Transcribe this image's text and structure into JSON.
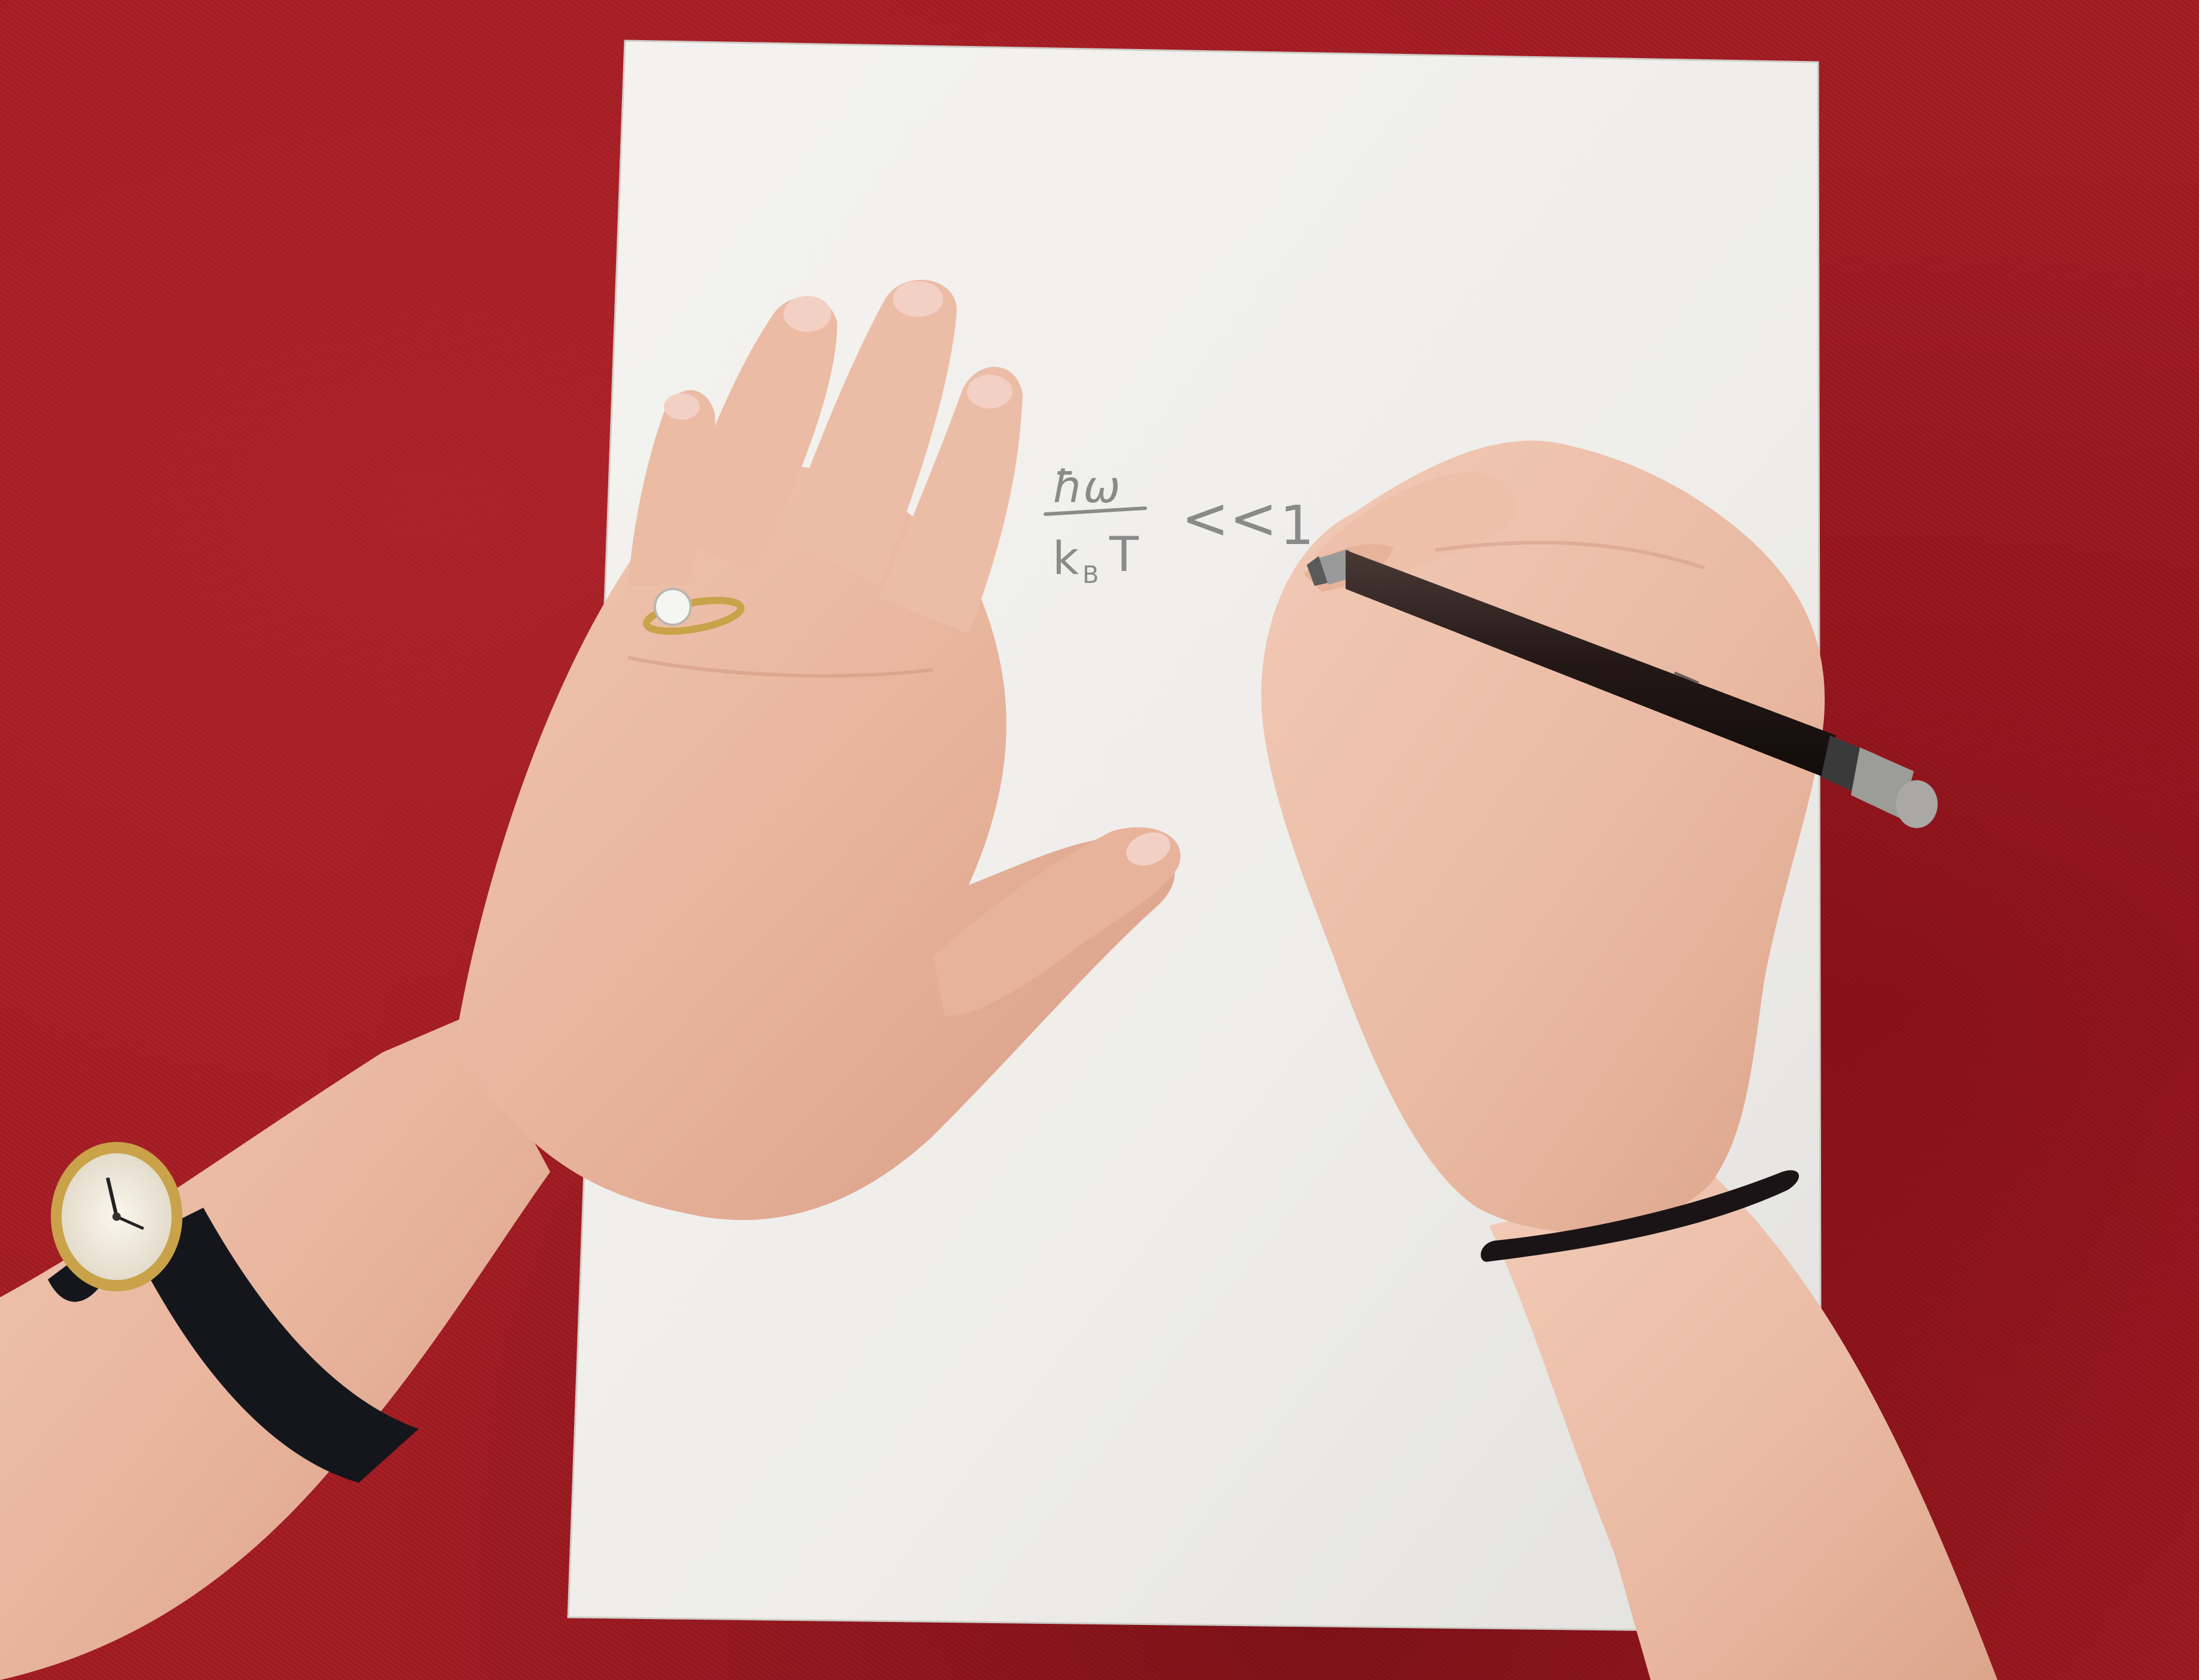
{
  "handwriting": {
    "numerator": "ħω",
    "denominator_k": "k",
    "denominator_sub": "B",
    "denominator_T": "T",
    "relation": "<<",
    "partial": "1"
  },
  "colors": {
    "tablecloth": "#a31b22",
    "paper": "#f2f1ee",
    "skin": "#e8b9a3",
    "pencil": "#2a1e1c",
    "watch_strap": "#14161c",
    "watch_case": "#c9a24a",
    "hair_tie": "#1a1416",
    "ink": "#8a8a8a"
  }
}
